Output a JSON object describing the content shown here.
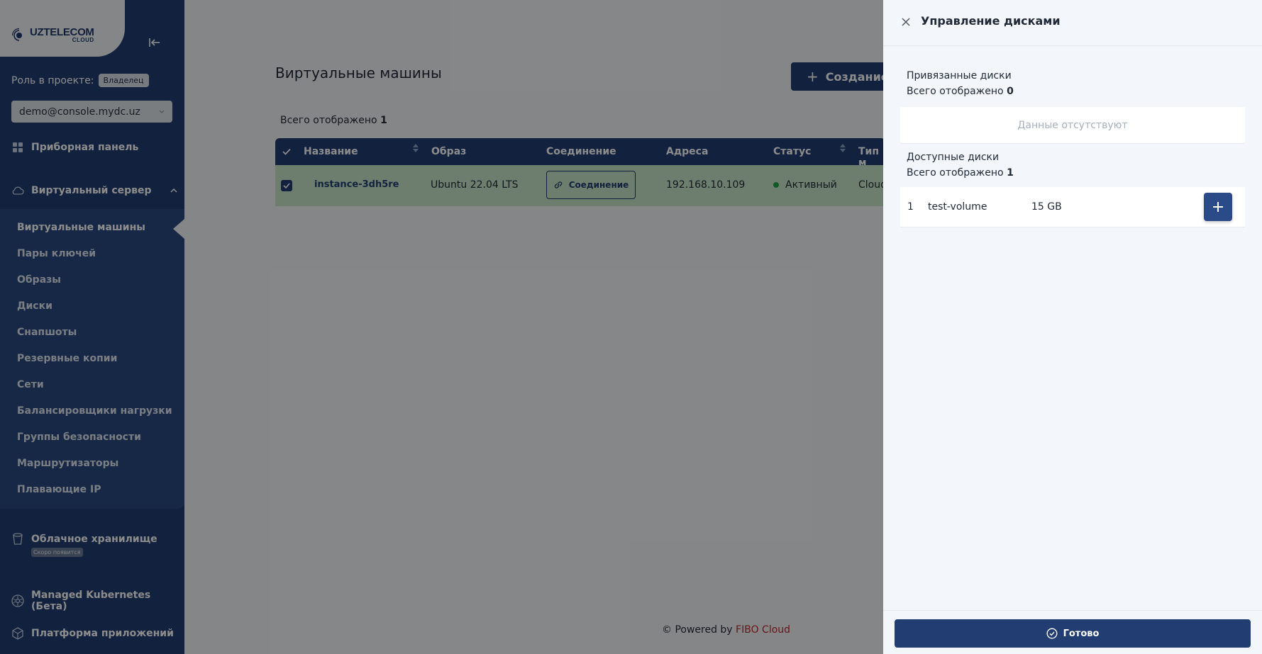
{
  "sidebar": {
    "logo": {
      "line1": "UZTELECOM",
      "line2": "CLOUD"
    },
    "role_label": "Роль в проекте:",
    "role_badge": "Владелец",
    "account": "demo@console.mydc.uz",
    "dashboard": "Приборная панель",
    "virtual_server": "Виртуальный сервер",
    "submenu": [
      "Виртуальные машины",
      "Пары ключей",
      "Образы",
      "Диски",
      "Снапшоты",
      "Резервные копии",
      "Сети",
      "Балансировщики нагрузки",
      "Группы безопасности",
      "Маршрутизаторы",
      "Плавающие IP"
    ],
    "cloud_storage": "Облачное хранилище",
    "soon_badge": "Скоро появится",
    "kubernetes": "Managed Kubernetes (Бета)",
    "app_platform": "Платформа приложений"
  },
  "main": {
    "title": "Виртуальные машины",
    "create_button": "Создание",
    "total_label": "Всего отображено",
    "total_value": "1",
    "columns": [
      "Название",
      "Образ",
      "Соединение",
      "Адреса",
      "Статус",
      "Тип м"
    ],
    "row": {
      "name": "instance-3dh5re",
      "image": "Ubuntu 22.04 LTS",
      "connect_button": "Соединение",
      "address": "192.168.10.109",
      "status": "Активный",
      "type": "Cloud"
    },
    "footer_prefix": "© Powered by",
    "footer_brand": "FIBO Cloud"
  },
  "drawer": {
    "title": "Управление дисками",
    "attached_label": "Привязанные диски",
    "attached_total_label": "Всего отображено",
    "attached_total_value": "0",
    "empty_text": "Данные отсутствуют",
    "available_label": "Доступные диски",
    "available_total_label": "Всего отображено",
    "available_total_value": "1",
    "disks": [
      {
        "index": "1",
        "name": "test-volume",
        "size": "15 GB"
      }
    ],
    "done_button": "Готово"
  },
  "colors": {
    "primary": "#223d71",
    "row_selected": "#c8e6c9",
    "status_active": "#22a34a",
    "brand_red": "#c0262d"
  }
}
